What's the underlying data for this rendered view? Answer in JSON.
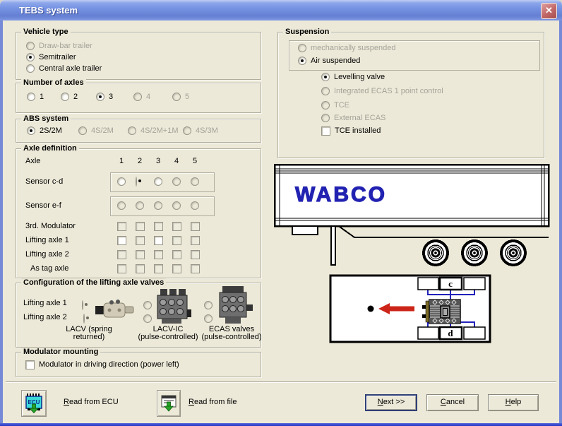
{
  "window": {
    "title": "TEBS system"
  },
  "icons": {
    "close": "✕"
  },
  "vehicle_type": {
    "title": "Vehicle type",
    "options": [
      {
        "label": "Draw-bar trailer",
        "state": "disabled"
      },
      {
        "label": "Semitrailer",
        "state": "selected"
      },
      {
        "label": "Central axle trailer",
        "state": "enabled"
      }
    ]
  },
  "number_of_axles": {
    "title": "Number of axles",
    "options": [
      {
        "label": "1",
        "state": "enabled"
      },
      {
        "label": "2",
        "state": "enabled"
      },
      {
        "label": "3",
        "state": "selected"
      },
      {
        "label": "4",
        "state": "disabled"
      },
      {
        "label": "5",
        "state": "disabled"
      }
    ]
  },
  "abs_system": {
    "title": "ABS system",
    "options": [
      {
        "label": "2S/2M",
        "state": "selected"
      },
      {
        "label": "4S/2M",
        "state": "disabled"
      },
      {
        "label": "4S/2M+1M",
        "state": "disabled"
      },
      {
        "label": "4S/3M",
        "state": "disabled"
      }
    ]
  },
  "axle_definition": {
    "title": "Axle definition",
    "row_header": "Axle",
    "columns": [
      "1",
      "2",
      "3",
      "4",
      "5"
    ],
    "rows": [
      {
        "label": "Sensor c-d",
        "type": "radio",
        "cells": [
          "on",
          "sel",
          "on",
          "off",
          "off"
        ]
      },
      {
        "label": "Sensor e-f",
        "type": "radio",
        "cells": [
          "off",
          "off",
          "off",
          "off",
          "off"
        ]
      },
      {
        "label": "3rd. Modulator",
        "type": "check",
        "cells": [
          "off",
          "off",
          "off",
          "off",
          "off"
        ]
      },
      {
        "label": "Lifting axle 1",
        "type": "check",
        "cells": [
          "on",
          "off",
          "on",
          "off",
          "off"
        ]
      },
      {
        "label": "Lifting axle 2",
        "type": "check",
        "cells": [
          "off",
          "off",
          "off",
          "off",
          "off"
        ]
      },
      {
        "label": "As tag axle",
        "type": "check",
        "cells": [
          "off",
          "off",
          "off",
          "off",
          "off"
        ]
      }
    ]
  },
  "lifting_valves": {
    "title": "Configuration of the lifting axle valves",
    "rows": [
      {
        "label": "Lifting axle 1"
      },
      {
        "label": "Lifting axle 2"
      }
    ],
    "valves": [
      {
        "caption": "LACV (spring\nreturned)"
      },
      {
        "caption": "LACV-IC\n(pulse-controlled)"
      },
      {
        "caption": "ECAS valves\n(pulse-controlled)"
      }
    ]
  },
  "modulator_mounting": {
    "title": "Modulator mounting",
    "checkbox_label": "Modulator in driving direction (power left)"
  },
  "suspension": {
    "title": "Suspension",
    "main_options": [
      {
        "label": "mechanically suspended",
        "state": "disabled"
      },
      {
        "label": "Air suspended",
        "state": "selected"
      }
    ],
    "sub_options": [
      {
        "label": "Levelling valve",
        "state": "selected"
      },
      {
        "label": "Integrated ECAS 1 point control",
        "state": "disabled"
      },
      {
        "label": "TCE",
        "state": "disabled"
      },
      {
        "label": "External ECAS",
        "state": "disabled"
      }
    ],
    "checkbox_label": "TCE installed"
  },
  "trailer": {
    "logo": "WABCO"
  },
  "diagram": {
    "top_label": "c",
    "bottom_label": "d"
  },
  "footer": {
    "ecu_icon_text": "ECU",
    "read_ecu_label": "Read from ECU",
    "read_file_label": "Read from file",
    "next_label": "Next >>",
    "cancel_label": "Cancel",
    "help_label": "Help"
  },
  "colors": {
    "dialog_bg": "#ece9d8",
    "border_blue": "#7589d6",
    "wabco_blue": "#2222b2",
    "line_blue": "#2222bb",
    "arrow_red": "#cc2418",
    "ecu_cyan": "#3cd9d9",
    "arrow_green": "#27a327"
  }
}
